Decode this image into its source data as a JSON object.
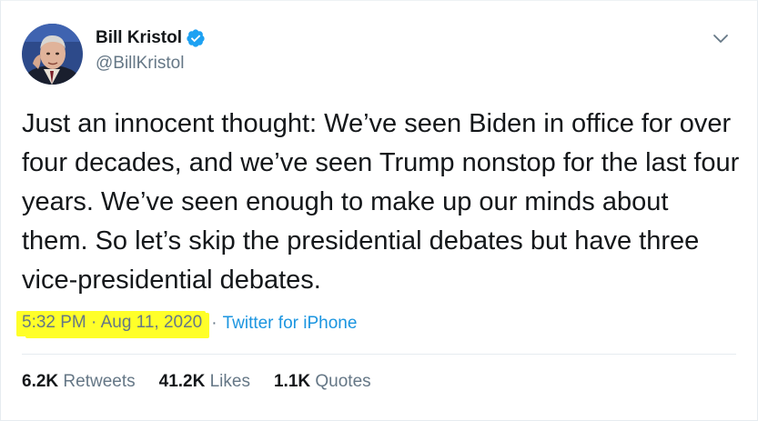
{
  "author": {
    "display_name": "Bill Kristol",
    "handle": "@BillKristol",
    "verified": true,
    "avatar_icon": "profile-photo"
  },
  "tweet": {
    "text": "Just an innocent thought: We’ve seen Biden in office for over four decades, and we’ve seen Trump nonstop for the last four years. We’ve seen enough to make up our minds about them. So let’s skip the presidential debates but have three vice-presidential debates.",
    "timestamp": "5:32 PM · Aug 11, 2020",
    "separator": "·",
    "source": "Twitter for iPhone"
  },
  "stats": [
    {
      "count": "6.2K",
      "label": "Retweets"
    },
    {
      "count": "41.2K",
      "label": "Likes"
    },
    {
      "count": "1.1K",
      "label": "Quotes"
    }
  ],
  "colors": {
    "text_primary": "#14171a",
    "text_secondary": "#657786",
    "link": "#1b95e0",
    "verified": "#1da1f2",
    "highlight": "#ffff29"
  }
}
